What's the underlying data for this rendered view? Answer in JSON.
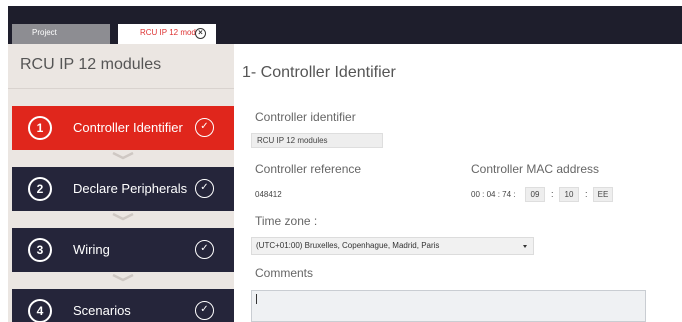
{
  "tabs": [
    {
      "label": "Project"
    },
    {
      "label": "RCU IP 12 mod"
    }
  ],
  "sidebar": {
    "title": "RCU IP 12 modules",
    "steps": [
      {
        "num": "1",
        "label": "Controller Identifier",
        "active": true
      },
      {
        "num": "2",
        "label": "Declare Peripherals",
        "active": false
      },
      {
        "num": "3",
        "label": "Wiring",
        "active": false
      },
      {
        "num": "4",
        "label": "Scenarios",
        "active": false
      }
    ]
  },
  "main": {
    "title": "1- Controller Identifier",
    "identifier": {
      "label": "Controller identifier",
      "value": "RCU IP 12 modules"
    },
    "reference": {
      "label": "Controller reference",
      "value": "048412"
    },
    "mac": {
      "label": "Controller MAC address",
      "fixed": "00 : 04 : 74 :",
      "b1": "09",
      "b2": "10",
      "b3": "EE",
      "sep": ":"
    },
    "timezone": {
      "label": "Time zone :",
      "value": "(UTC+01:00) Bruxelles, Copenhague, Madrid, Paris"
    },
    "comments": {
      "label": "Comments",
      "value": ""
    }
  },
  "colors": {
    "active_step": "#e0261c",
    "step": "#25253a",
    "topbar": "#1e1e2c",
    "sidebar": "#ebe6e2"
  }
}
